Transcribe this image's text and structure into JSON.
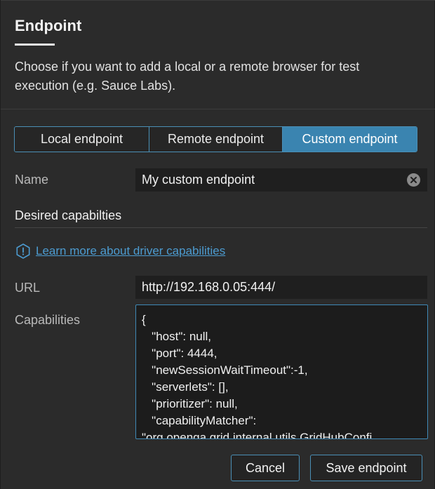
{
  "dialog": {
    "title": "Endpoint",
    "description": "Choose if you want to add a local or a remote browser for test execution (e.g. Sauce Labs)."
  },
  "tabs": [
    {
      "label": "Local endpoint",
      "active": false
    },
    {
      "label": "Remote endpoint",
      "active": false
    },
    {
      "label": "Custom endpoint",
      "active": true
    }
  ],
  "name_field": {
    "label": "Name",
    "value": "My custom endpoint"
  },
  "capabilities_section": {
    "title": "Desired capabilties",
    "link_text": "Learn more about driver capabilities",
    "info_icon": "info-icon"
  },
  "url_field": {
    "label": "URL",
    "value": "http://192.168.0.05:444/"
  },
  "capabilities_field": {
    "label": "Capabilities",
    "value": "{\n   \"host\": null,\n   \"port\": 4444,\n   \"newSessionWaitTimeout\":-1,\n   \"serverlets\": [],\n   \"prioritizer\": null,\n   \"capabilityMatcher\":\n\"org.openqa.grid.internal.utils.GridHubConfi"
  },
  "buttons": {
    "cancel": "Cancel",
    "save": "Save endpoint"
  },
  "colors": {
    "accent": "#3a84b0",
    "link": "#4c9bd0",
    "background": "#2b2b2b",
    "input_background": "#1f1f1f"
  }
}
